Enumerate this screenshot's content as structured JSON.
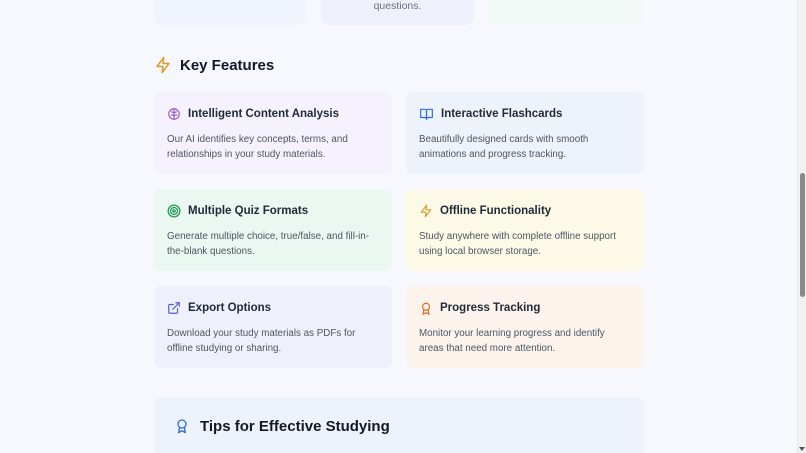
{
  "top_cards": [
    {
      "text": ""
    },
    {
      "text": "questions."
    },
    {
      "text": ""
    }
  ],
  "key_features": {
    "title": "Key Features",
    "icon": "lightning-icon",
    "cards": [
      {
        "title": "Intelligent Content Analysis",
        "desc": "Our AI identifies key concepts, terms, and relationships in your study materials.",
        "icon": "brain-icon",
        "color": "#9b59d0"
      },
      {
        "title": "Interactive Flashcards",
        "desc": "Beautifully designed cards with smooth animations and progress tracking.",
        "icon": "book-open-icon",
        "color": "#2f6fd6"
      },
      {
        "title": "Multiple Quiz Formats",
        "desc": "Generate multiple choice, true/false, and fill-in-the-blank questions.",
        "icon": "target-icon",
        "color": "#1f9d55"
      },
      {
        "title": "Offline Functionality",
        "desc": "Study anywhere with complete offline support using local browser storage.",
        "icon": "lightning-icon",
        "color": "#d69e2e"
      },
      {
        "title": "Export Options",
        "desc": "Download your study materials as PDFs for offline studying or sharing.",
        "icon": "external-link-icon",
        "color": "#4f5bd5"
      },
      {
        "title": "Progress Tracking",
        "desc": "Monitor your learning progress and identify areas that need more attention.",
        "icon": "award-icon",
        "color": "#dd6b20"
      }
    ]
  },
  "tips": {
    "title": "Tips for Effective Studying",
    "icon": "award-icon",
    "color": "#2f6fd6"
  }
}
